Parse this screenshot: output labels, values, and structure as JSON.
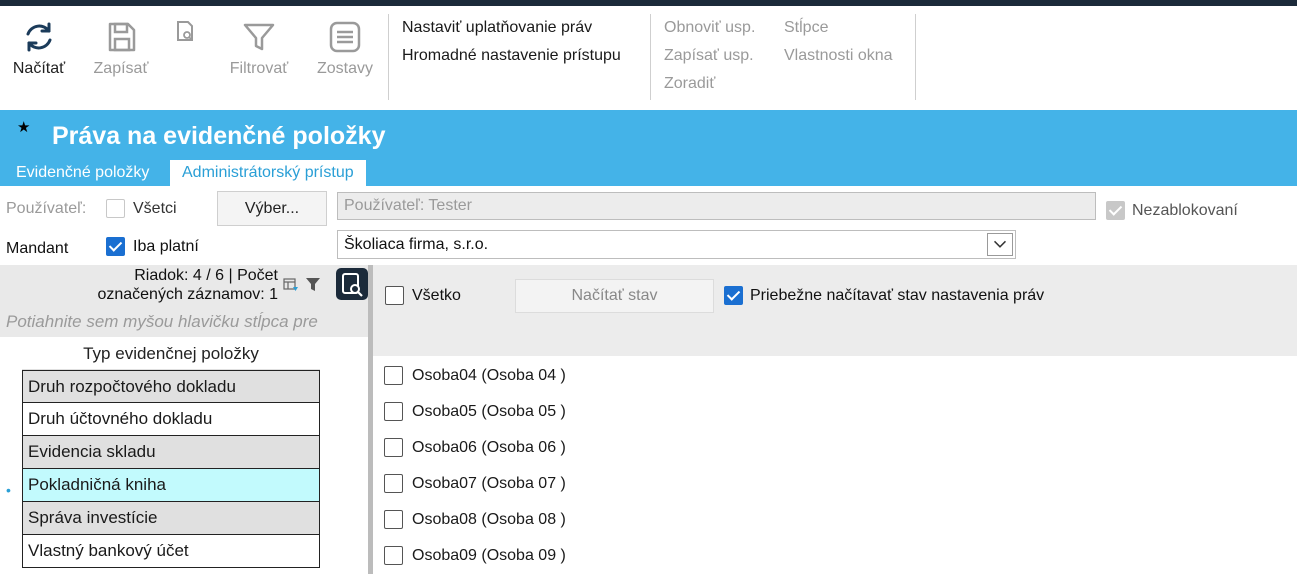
{
  "ribbon": {
    "load_label": "Načítať",
    "save_label": "Zapísať",
    "filter_label": "Filtrovať",
    "reports_label": "Zostavy",
    "menu1": [
      "Nastaviť uplatňovanie práv",
      "Hromadné nastavenie prístupu"
    ],
    "menu2": [
      "Obnoviť usp.",
      "Zapísať usp.",
      "Zoradiť"
    ],
    "menu3": [
      "Stĺpce",
      "Vlastnosti okna"
    ]
  },
  "header": {
    "title": "Práva na evidenčné položky",
    "tabs": [
      {
        "label": "Evidenčné položky",
        "active": false
      },
      {
        "label": "Administrátorský prístup",
        "active": true
      }
    ]
  },
  "filters": {
    "user_label": "Používateľ:",
    "all_label": "Všetci",
    "all_checked": false,
    "select_button": "Výber...",
    "user_value": "Používateľ: Tester",
    "unblocked_label": "Nezablokovaní",
    "unblocked_checked": true,
    "mandant_label": "Mandant",
    "only_valid_label": "Iba platní",
    "only_valid_checked": true,
    "mandant_value": "Školiaca firma, s.r.o."
  },
  "left": {
    "row_info_line1": "Riadok: 4 / 6 | Počet",
    "row_info_line2": "označených záznamov: 1",
    "group_hint": "Potiahnite sem myšou hlavičku stĺpca pre",
    "column_header": "Typ evidenčnej položky",
    "rows": [
      "Druh rozpočtového dokladu",
      "Druh účtovného dokladu",
      "Evidencia skladu",
      "Pokladničná kniha",
      "Správa investície",
      "Vlastný bankový účet"
    ],
    "selected_index": 3
  },
  "right": {
    "all_label": "Všetko",
    "load_state_button": "Načítať stav",
    "auto_load_label": "Priebežne načítavať stav nastavenia práv",
    "auto_load_checked": true,
    "persons": [
      "Osoba04 (Osoba 04 )",
      "Osoba05 (Osoba 05 )",
      "Osoba06 (Osoba 06 )",
      "Osoba07 (Osoba 07 )",
      "Osoba08 (Osoba 08 )",
      "Osoba09 (Osoba 09 )"
    ]
  },
  "colors": {
    "header_bg": "#44b3e8",
    "accent": "#2a9fd6",
    "selected_row": "#c2fafd",
    "checkbox_checked": "#1a6fd1"
  }
}
